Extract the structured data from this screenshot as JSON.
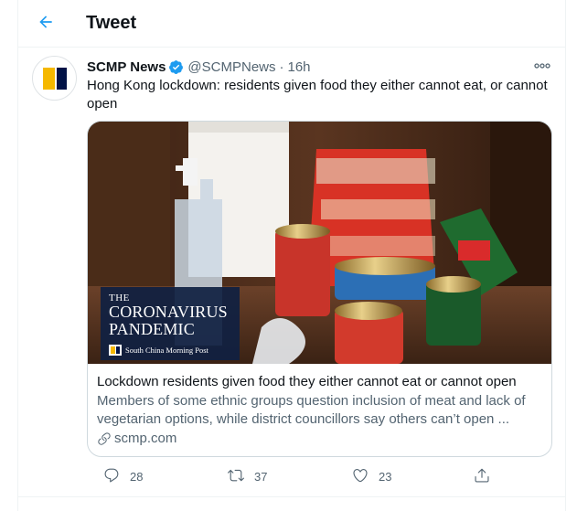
{
  "header": {
    "back_icon": "arrow-left-icon",
    "title": "Tweet"
  },
  "tweet": {
    "author": {
      "display_name": "SCMP News",
      "verified_icon": "verified-badge-icon",
      "handle": "@SCMPNews",
      "separator": "·",
      "time": "16h"
    },
    "more_icon": "more-horizontal-icon",
    "text": "Hong Kong lockdown: residents given food they either cannot eat, or cannot open",
    "card": {
      "badge": {
        "line1": "THE",
        "line2": "CORONAVIRUS",
        "line3": "PANDEMIC",
        "publisher": "South China Morning Post"
      },
      "title": "Lockdown residents given food they either cannot eat or cannot open",
      "description": "Members of some ethnic groups question inclusion of meat and lack of vegetarian options, while district councillors say others can’t open ...",
      "link_icon": "link-icon",
      "domain": "scmp.com"
    },
    "actions": {
      "reply_count": "28",
      "retweet_count": "37",
      "like_count": "23"
    }
  },
  "colors": {
    "accent": "#1d9bf0",
    "text": "#0f1419",
    "muted": "#536471",
    "border": "#cfd9de",
    "scmp_yellow": "#f5b800",
    "scmp_navy": "#001246"
  }
}
